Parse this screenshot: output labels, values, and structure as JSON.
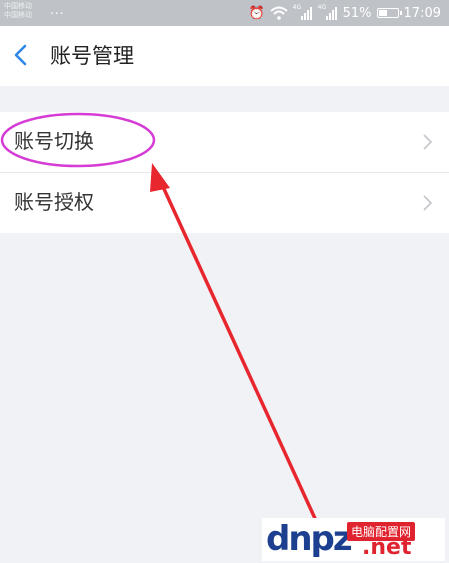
{
  "status_bar": {
    "carrier_1": "中国移动",
    "carrier_2": "中国移动",
    "dots": "...",
    "battery_percent": "51%",
    "time": "17:09",
    "signal_tag": "4G",
    "battery_level": 0.51
  },
  "header": {
    "title": "账号管理",
    "back_icon": "chevron-left-icon"
  },
  "menu": {
    "items": [
      {
        "label": "账号切换",
        "icon": "chevron-right-icon"
      },
      {
        "label": "账号授权",
        "icon": "chevron-right-icon"
      }
    ]
  },
  "annotation": {
    "ellipse_color": "#d63bd6",
    "arrow_color": "#e8262e"
  },
  "watermark": {
    "logo": "dnpz",
    "tagline": "电脑配置网",
    "domain": ".net"
  },
  "colors": {
    "accent": "#2f88e8",
    "status_bar": "#bfc3c8",
    "background": "#f0f2f5"
  }
}
